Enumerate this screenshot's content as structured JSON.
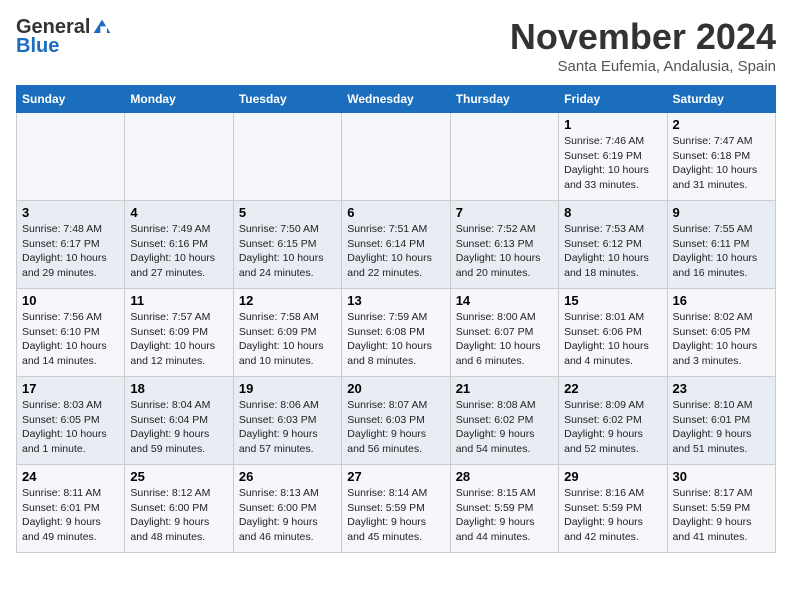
{
  "logo": {
    "general": "General",
    "blue": "Blue"
  },
  "header": {
    "month": "November 2024",
    "location": "Santa Eufemia, Andalusia, Spain"
  },
  "weekdays": [
    "Sunday",
    "Monday",
    "Tuesday",
    "Wednesday",
    "Thursday",
    "Friday",
    "Saturday"
  ],
  "weeks": [
    [
      {
        "day": "",
        "info": ""
      },
      {
        "day": "",
        "info": ""
      },
      {
        "day": "",
        "info": ""
      },
      {
        "day": "",
        "info": ""
      },
      {
        "day": "",
        "info": ""
      },
      {
        "day": "1",
        "info": "Sunrise: 7:46 AM\nSunset: 6:19 PM\nDaylight: 10 hours\nand 33 minutes."
      },
      {
        "day": "2",
        "info": "Sunrise: 7:47 AM\nSunset: 6:18 PM\nDaylight: 10 hours\nand 31 minutes."
      }
    ],
    [
      {
        "day": "3",
        "info": "Sunrise: 7:48 AM\nSunset: 6:17 PM\nDaylight: 10 hours\nand 29 minutes."
      },
      {
        "day": "4",
        "info": "Sunrise: 7:49 AM\nSunset: 6:16 PM\nDaylight: 10 hours\nand 27 minutes."
      },
      {
        "day": "5",
        "info": "Sunrise: 7:50 AM\nSunset: 6:15 PM\nDaylight: 10 hours\nand 24 minutes."
      },
      {
        "day": "6",
        "info": "Sunrise: 7:51 AM\nSunset: 6:14 PM\nDaylight: 10 hours\nand 22 minutes."
      },
      {
        "day": "7",
        "info": "Sunrise: 7:52 AM\nSunset: 6:13 PM\nDaylight: 10 hours\nand 20 minutes."
      },
      {
        "day": "8",
        "info": "Sunrise: 7:53 AM\nSunset: 6:12 PM\nDaylight: 10 hours\nand 18 minutes."
      },
      {
        "day": "9",
        "info": "Sunrise: 7:55 AM\nSunset: 6:11 PM\nDaylight: 10 hours\nand 16 minutes."
      }
    ],
    [
      {
        "day": "10",
        "info": "Sunrise: 7:56 AM\nSunset: 6:10 PM\nDaylight: 10 hours\nand 14 minutes."
      },
      {
        "day": "11",
        "info": "Sunrise: 7:57 AM\nSunset: 6:09 PM\nDaylight: 10 hours\nand 12 minutes."
      },
      {
        "day": "12",
        "info": "Sunrise: 7:58 AM\nSunset: 6:09 PM\nDaylight: 10 hours\nand 10 minutes."
      },
      {
        "day": "13",
        "info": "Sunrise: 7:59 AM\nSunset: 6:08 PM\nDaylight: 10 hours\nand 8 minutes."
      },
      {
        "day": "14",
        "info": "Sunrise: 8:00 AM\nSunset: 6:07 PM\nDaylight: 10 hours\nand 6 minutes."
      },
      {
        "day": "15",
        "info": "Sunrise: 8:01 AM\nSunset: 6:06 PM\nDaylight: 10 hours\nand 4 minutes."
      },
      {
        "day": "16",
        "info": "Sunrise: 8:02 AM\nSunset: 6:05 PM\nDaylight: 10 hours\nand 3 minutes."
      }
    ],
    [
      {
        "day": "17",
        "info": "Sunrise: 8:03 AM\nSunset: 6:05 PM\nDaylight: 10 hours\nand 1 minute."
      },
      {
        "day": "18",
        "info": "Sunrise: 8:04 AM\nSunset: 6:04 PM\nDaylight: 9 hours\nand 59 minutes."
      },
      {
        "day": "19",
        "info": "Sunrise: 8:06 AM\nSunset: 6:03 PM\nDaylight: 9 hours\nand 57 minutes."
      },
      {
        "day": "20",
        "info": "Sunrise: 8:07 AM\nSunset: 6:03 PM\nDaylight: 9 hours\nand 56 minutes."
      },
      {
        "day": "21",
        "info": "Sunrise: 8:08 AM\nSunset: 6:02 PM\nDaylight: 9 hours\nand 54 minutes."
      },
      {
        "day": "22",
        "info": "Sunrise: 8:09 AM\nSunset: 6:02 PM\nDaylight: 9 hours\nand 52 minutes."
      },
      {
        "day": "23",
        "info": "Sunrise: 8:10 AM\nSunset: 6:01 PM\nDaylight: 9 hours\nand 51 minutes."
      }
    ],
    [
      {
        "day": "24",
        "info": "Sunrise: 8:11 AM\nSunset: 6:01 PM\nDaylight: 9 hours\nand 49 minutes."
      },
      {
        "day": "25",
        "info": "Sunrise: 8:12 AM\nSunset: 6:00 PM\nDaylight: 9 hours\nand 48 minutes."
      },
      {
        "day": "26",
        "info": "Sunrise: 8:13 AM\nSunset: 6:00 PM\nDaylight: 9 hours\nand 46 minutes."
      },
      {
        "day": "27",
        "info": "Sunrise: 8:14 AM\nSunset: 5:59 PM\nDaylight: 9 hours\nand 45 minutes."
      },
      {
        "day": "28",
        "info": "Sunrise: 8:15 AM\nSunset: 5:59 PM\nDaylight: 9 hours\nand 44 minutes."
      },
      {
        "day": "29",
        "info": "Sunrise: 8:16 AM\nSunset: 5:59 PM\nDaylight: 9 hours\nand 42 minutes."
      },
      {
        "day": "30",
        "info": "Sunrise: 8:17 AM\nSunset: 5:59 PM\nDaylight: 9 hours\nand 41 minutes."
      }
    ]
  ]
}
